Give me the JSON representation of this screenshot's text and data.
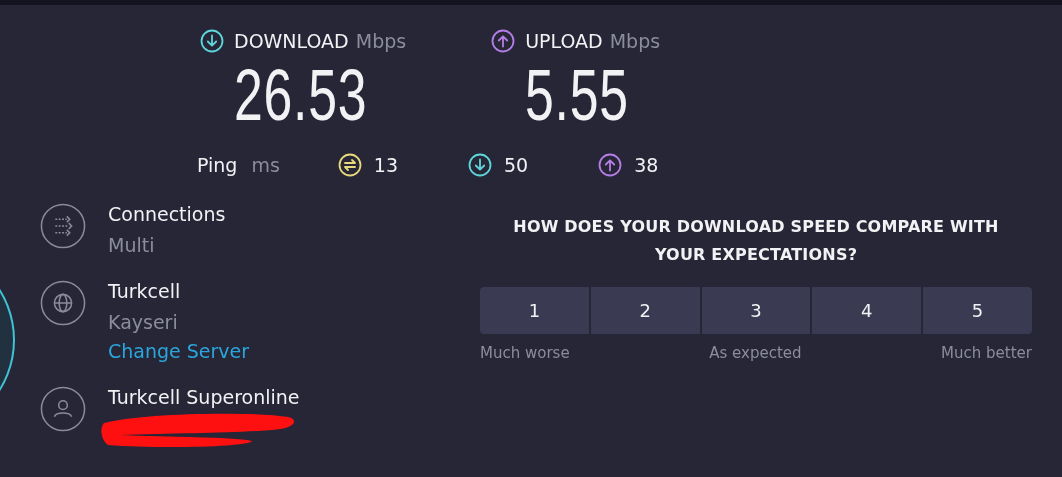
{
  "download": {
    "label": "DOWNLOAD",
    "unit": "Mbps",
    "value": "26.53"
  },
  "upload": {
    "label": "UPLOAD",
    "unit": "Mbps",
    "value": "5.55"
  },
  "ping": {
    "label": "Ping",
    "unit": "ms",
    "readings": [
      {
        "kind": "idle",
        "value": "13"
      },
      {
        "kind": "download",
        "value": "50"
      },
      {
        "kind": "upload",
        "value": "38"
      }
    ]
  },
  "details": [
    {
      "kind": "connections",
      "title": "Connections",
      "subtitle": "Multi"
    },
    {
      "kind": "server",
      "title": "Turkcell",
      "subtitle": "Kayseri",
      "link": "Change Server"
    },
    {
      "kind": "provider",
      "title": "Turkcell Superonline",
      "redacted": true
    }
  ],
  "survey": {
    "question": "HOW DOES YOUR DOWNLOAD SPEED COMPARE WITH YOUR EXPECTATIONS?",
    "options": [
      "1",
      "2",
      "3",
      "4",
      "5"
    ],
    "scale_labels": [
      "Much worse",
      "As expected",
      "Much better"
    ]
  }
}
